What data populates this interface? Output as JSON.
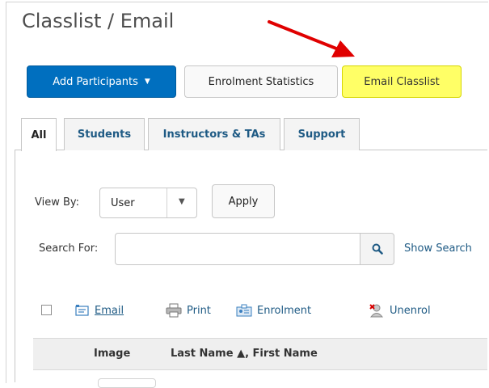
{
  "page": {
    "title": "Classlist / Email"
  },
  "toolbar": {
    "add_participants_label": "Add Participants",
    "enrolment_statistics_label": "Enrolment Statistics",
    "email_classlist_label": "Email Classlist",
    "highlight_color": "#ffff66",
    "primary_color": "#006fbf",
    "annotation_arrow_color": "#e00000"
  },
  "tabs": [
    {
      "label": "All",
      "active": true
    },
    {
      "label": "Students",
      "active": false
    },
    {
      "label": "Instructors & TAs",
      "active": false
    },
    {
      "label": "Support",
      "active": false
    }
  ],
  "filters": {
    "view_by_label": "View By:",
    "view_by_value": "User",
    "apply_label": "Apply",
    "search_for_label": "Search For:",
    "search_value": "",
    "show_search_label": "Show Search"
  },
  "actions": [
    {
      "label": "Email",
      "icon": "email-icon",
      "is_link": true
    },
    {
      "label": "Print",
      "icon": "printer-icon",
      "is_link": false
    },
    {
      "label": "Enrolment",
      "icon": "enrolment-icon",
      "is_link": false
    },
    {
      "label": "Unenrol",
      "icon": "unenrol-icon",
      "is_link": false
    }
  ],
  "table": {
    "columns": [
      "Image",
      "Last Name ▲, First Name"
    ]
  }
}
